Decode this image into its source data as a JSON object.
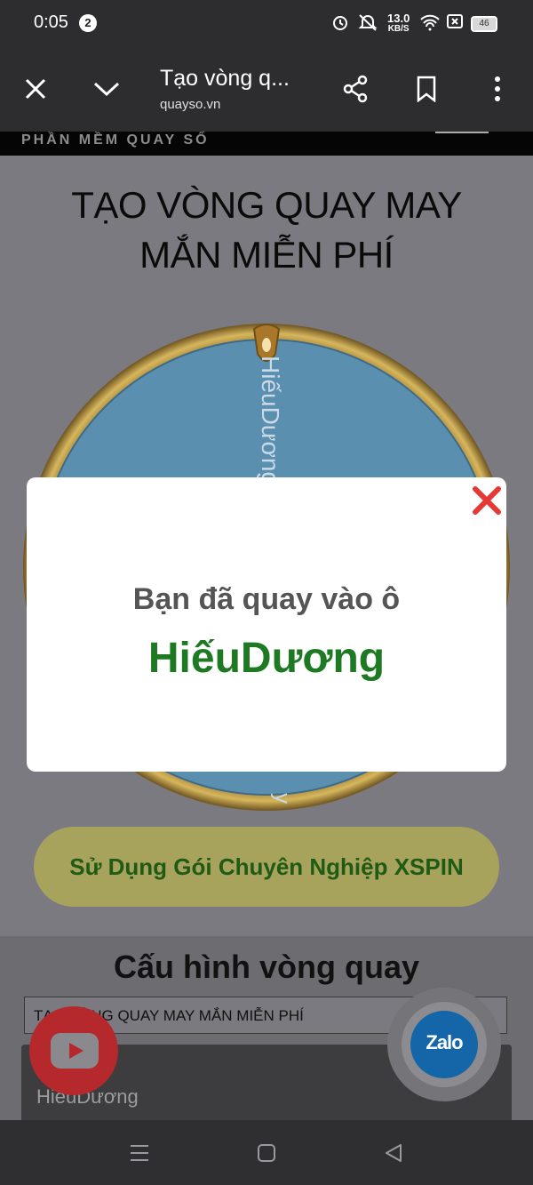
{
  "status_bar": {
    "time": "0:05",
    "notification_count": "2",
    "net_speed_value": "13.0",
    "net_speed_unit": "KB/S",
    "battery": "46"
  },
  "browser": {
    "page_title": "Tạo vòng q...",
    "url": "quayso.vn"
  },
  "page": {
    "banner_text": "PHẦN MỀM QUAY SỐ",
    "heading_line1": "TẠO VÒNG QUAY MAY",
    "heading_line2": "MẮN MIỄN PHÍ",
    "wheel_segment_label": "HiếuDương",
    "promo_button_label": "Sử Dụng Gói Chuyên Nghiệp XSPIN",
    "config_title": "Cấu hình vòng quay",
    "wheel_title_input_value": "TẠO VÒNG QUAY MAY MẮN MIỄN PHÍ",
    "entries": [
      "HiếuDương"
    ],
    "zalo_label": "Zalo"
  },
  "modal": {
    "message": "Bạn đã quay vào ô",
    "result": "HiếuDương"
  },
  "colors": {
    "wheel_blue": "#5b8fb0",
    "wheel_gold": "#c79a3c",
    "result_green": "#1e7a22",
    "close_red": "#e53935"
  }
}
